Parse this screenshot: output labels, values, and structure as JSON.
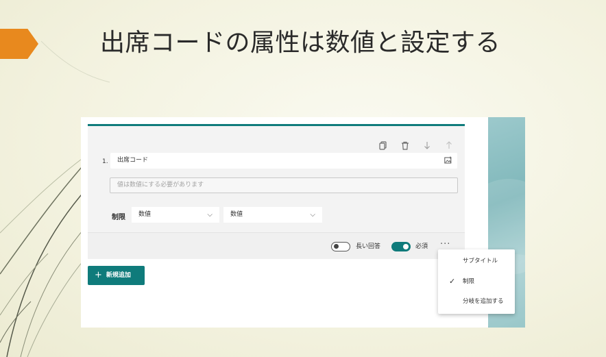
{
  "slide": {
    "title": "出席コードの属性は数値と設定する"
  },
  "colors": {
    "accent_orange": "#e8891e",
    "teal": "#0f7b7b"
  },
  "question": {
    "number": "1.",
    "title": "出席コード",
    "answer_placeholder": "値は数値にする必要があります",
    "restriction_label": "制限",
    "restriction_type": "数値",
    "restriction_condition": "数値"
  },
  "toolbar": {
    "icons": [
      "copy-icon",
      "delete-icon",
      "move-down-icon",
      "move-up-icon"
    ]
  },
  "footer": {
    "long_answer_label": "長い回答",
    "long_answer_on": false,
    "required_label": "必須",
    "required_on": true,
    "more_label": "···"
  },
  "add_button": {
    "label": "新規追加"
  },
  "menu": {
    "items": [
      {
        "label": "サブタイトル",
        "checked": false
      },
      {
        "label": "制限",
        "checked": true
      },
      {
        "label": "分岐を追加する",
        "checked": false
      }
    ]
  }
}
